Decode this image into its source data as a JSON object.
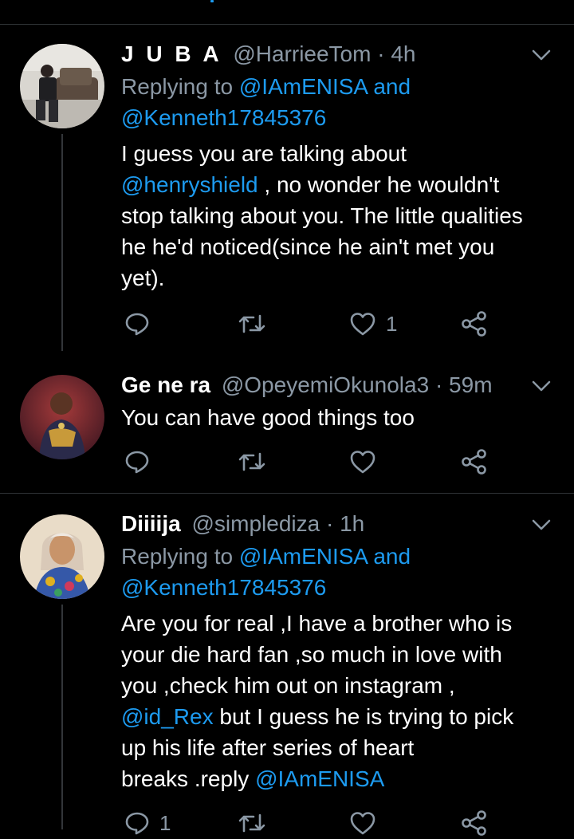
{
  "tweets": [
    {
      "name": "J U B A",
      "handle": "@HarrieeTom",
      "time": "· 4h",
      "replying_prefix": "Replying to",
      "replying_mention": "@IAmENISA",
      "replying_and": "and",
      "replying_mention2": "@Kenneth17845376",
      "body_l1": "I guess you are talking about",
      "body_mention": "@henryshield",
      "body_l2": " , no wonder he wouldn't",
      "body_l3": "stop talking about you. The little qualities",
      "body_l4": "he he'd noticed(since he ain't met you",
      "body_l5": "yet).",
      "like_count": "1"
    },
    {
      "name": "Ge ne ra",
      "handle": "@OpeyemiOkunola3",
      "time": "· 59m",
      "body": "You can have good things too"
    },
    {
      "name": "Diiiija",
      "handle": "@simplediza",
      "time": "· 1h",
      "replying_prefix": "Replying to",
      "replying_mention": "@IAmENISA",
      "replying_and": "and",
      "replying_mention2": "@Kenneth17845376",
      "body_l1": "Are you for real ,I have a brother who is",
      "body_l2": "your die hard fan ,so much in love with",
      "body_l3": "you ,check him out on instagram ,",
      "body_mention": "@id_Rex",
      "body_l4": " but I guess he is trying to pick",
      "body_l5": "up his life after series of heart",
      "body_l6": "breaks .reply ",
      "body_mention2": "@IAmENISA",
      "reply_count": "1"
    }
  ],
  "colors": {
    "background": "#000000",
    "text": "#ffffff",
    "secondary": "#8b98a5",
    "link": "#1d9bf0",
    "divider": "#2f3336"
  },
  "icons": [
    "reply-icon",
    "retweet-icon",
    "like-icon",
    "share-icon",
    "chevron-down-icon"
  ]
}
